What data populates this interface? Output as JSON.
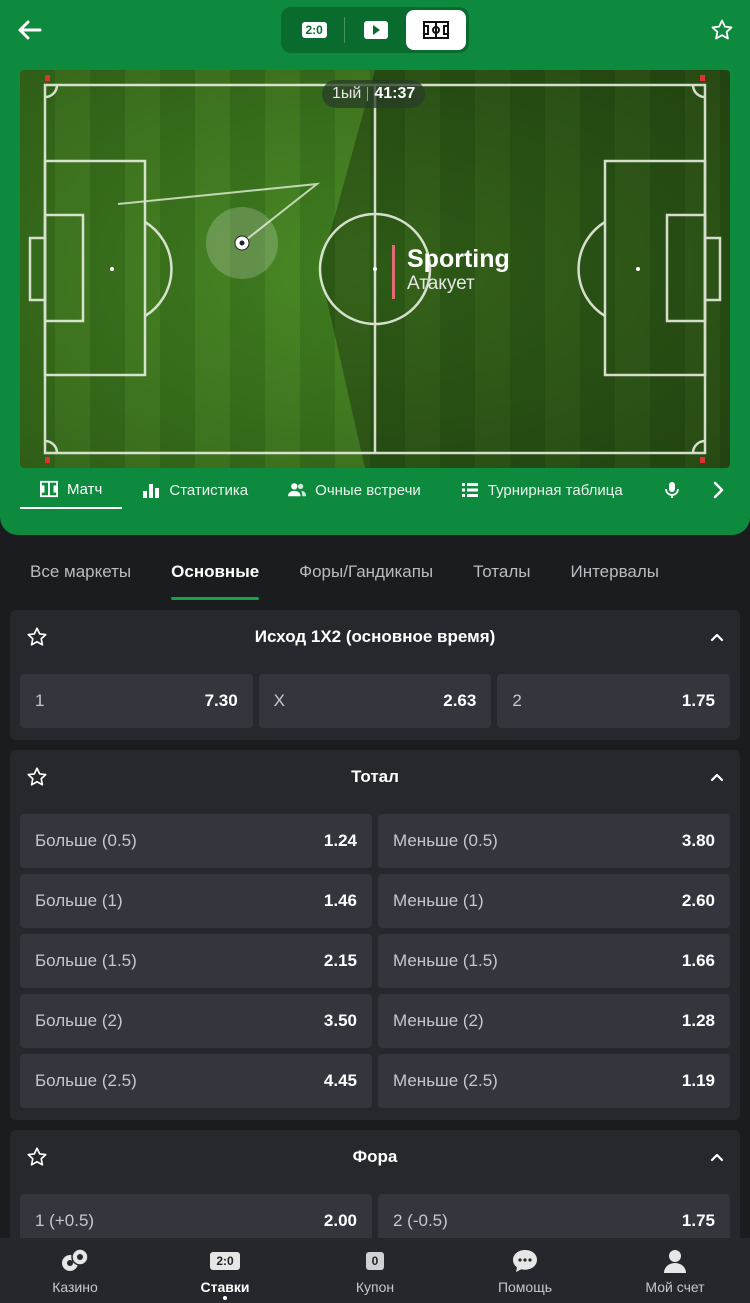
{
  "header": {
    "switcher": [
      {
        "name": "score",
        "label": "2:0"
      },
      {
        "name": "video",
        "label": ""
      },
      {
        "name": "pitch",
        "label": ""
      }
    ]
  },
  "pitch": {
    "period": "1ый",
    "time": "41:37",
    "team": "Sporting",
    "state": "Атакует"
  },
  "match_tabs": [
    "Матч",
    "Статистика",
    "Очные встречи",
    "Турнирная таблица"
  ],
  "category_tabs": [
    "Все маркеты",
    "Основные",
    "Форы/Гандикапы",
    "Тоталы",
    "Интервалы"
  ],
  "markets": [
    {
      "title": "Исход 1X2 (основное время)",
      "rows": [
        [
          {
            "label": "1",
            "value": "7.30"
          },
          {
            "label": "X",
            "value": "2.63"
          },
          {
            "label": "2",
            "value": "1.75"
          }
        ]
      ]
    },
    {
      "title": "Тотал",
      "rows": [
        [
          {
            "label": "Больше (0.5)",
            "value": "1.24"
          },
          {
            "label": "Меньше (0.5)",
            "value": "3.80"
          }
        ],
        [
          {
            "label": "Больше (1)",
            "value": "1.46"
          },
          {
            "label": "Меньше (1)",
            "value": "2.60"
          }
        ],
        [
          {
            "label": "Больше (1.5)",
            "value": "2.15"
          },
          {
            "label": "Меньше (1.5)",
            "value": "1.66"
          }
        ],
        [
          {
            "label": "Больше (2)",
            "value": "3.50"
          },
          {
            "label": "Меньше (2)",
            "value": "1.28"
          }
        ],
        [
          {
            "label": "Больше (2.5)",
            "value": "4.45"
          },
          {
            "label": "Меньше (2.5)",
            "value": "1.19"
          }
        ]
      ]
    },
    {
      "title": "Фора",
      "rows": [
        [
          {
            "label": "1 (+0.5)",
            "value": "2.00"
          },
          {
            "label": "2 (-0.5)",
            "value": "1.75"
          }
        ]
      ]
    }
  ],
  "bottom_nav": [
    {
      "label": "Казино",
      "badge": ""
    },
    {
      "label": "Ставки",
      "badge": "2:0"
    },
    {
      "label": "Купон",
      "badge": "0"
    },
    {
      "label": "Помощь",
      "badge": ""
    },
    {
      "label": "Мой счет",
      "badge": ""
    }
  ],
  "colors": {
    "brand": "#0e8a3e",
    "accent": "#15a24a",
    "attack_line": "#e26a72",
    "background": "#1b1c1f"
  }
}
